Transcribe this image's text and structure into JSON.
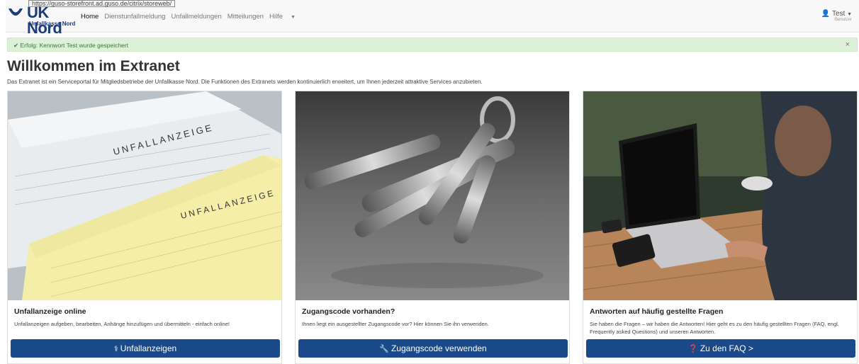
{
  "browser": {
    "url": "https://guso-storefront.ad.guso.de/citrix/storeweb/"
  },
  "brand": {
    "name": "UK Nord",
    "subtitle": "Unfallkasse Nord",
    "color": "#1a3c7a"
  },
  "nav": {
    "items": [
      {
        "label": "Home",
        "active": true
      },
      {
        "label": "Dienstunfallmeldung",
        "active": false
      },
      {
        "label": "Unfallmeldungen",
        "active": false
      },
      {
        "label": "Mitteilungen",
        "active": false
      },
      {
        "label": "Hilfe",
        "active": false,
        "dropdown": true
      }
    ],
    "user": {
      "name": "Test",
      "role": "Benutzer",
      "icon": "user-icon"
    }
  },
  "alert": {
    "icon": "check-icon",
    "label": "Erfolg:",
    "message": "Kennwort Test wurde gespeichert",
    "close": "×",
    "color": "#dff0d8"
  },
  "main": {
    "title": "Willkommen im Extranet",
    "intro": "Das Extranet ist ein Serviceportal für Mitgliedsbetriebe der Unfallkasse Nord. Die Funktionen des Extranets werden kontinuierlich erweitert, um Ihnen jederzeit attraktive Services anzubieten."
  },
  "cards": [
    {
      "title": "Unfallanzeige online",
      "text": "Unfallanzeigen aufgeben, bearbeiten, Anhänge hinzufügen und übermitteln - einfach online!",
      "button": "Unfallanzeigen",
      "button_icon": "medical-icon",
      "image_text": [
        "UNFALLANZEIGE",
        "UNFALLANZEIGE"
      ]
    },
    {
      "title": "Zugangscode vorhanden?",
      "text": "Ihnen liegt ein ausgestellter Zugangscode vor? Hier können Sie ihn verwenden.",
      "button": "Zugangscode verwenden",
      "button_icon": "wrench-icon"
    },
    {
      "title": "Antworten auf häufig gestellte Fragen",
      "text": "Sie haben die Fragen – wir haben die Antworten! Hier geht es zu den häufig gestellten Fragen (FAQ, engl. Frequently asked Questions) und unseren Antworten.",
      "button": "Zu den FAQ >",
      "button_icon": "question-icon"
    }
  ],
  "colors": {
    "button": "#1a4a8a",
    "success_text": "#3c763d"
  }
}
